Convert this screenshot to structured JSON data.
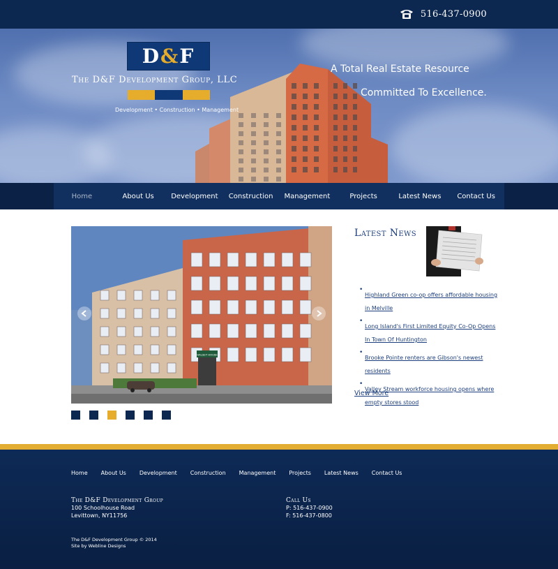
{
  "header": {
    "phone": "516-437-0900",
    "phone_icon": "telephone-icon"
  },
  "hero": {
    "logo_letters": {
      "left": "D",
      "amp": "&",
      "right": "F"
    },
    "company_name": "The D&F Development Group, LLC",
    "tagline": "Development • Construction • Management",
    "slogan_line1": "A Total Real Estate Resource",
    "slogan_line2": "Committed To Excellence.",
    "colors": {
      "navy": "#0f3877",
      "gold": "#e6ac2b"
    }
  },
  "nav": {
    "items": [
      {
        "label": "Home",
        "active": true
      },
      {
        "label": "About Us"
      },
      {
        "label": "Development"
      },
      {
        "label": "Construction"
      },
      {
        "label": "Management"
      },
      {
        "label": "Projects"
      },
      {
        "label": "Latest News"
      },
      {
        "label": "Contact Us"
      }
    ]
  },
  "slideshow": {
    "sign_text": "HALSEY HOUSE",
    "dots": 6,
    "active_dot": 3
  },
  "news": {
    "title": "Latest News",
    "items": [
      {
        "text": "Highland Green co-op offers affordable housing in Melville"
      },
      {
        "text": "Long Island's First Limited Equity Co-Op Opens In Town Of Huntington"
      },
      {
        "text": "Brooke Pointe renters are Gibson's newest residents"
      },
      {
        "text": "Valley Stream workforce housing opens where empty stores stood"
      }
    ],
    "view_more": "View More"
  },
  "footer": {
    "nav": [
      "Home",
      "About Us",
      "Development",
      "Construction",
      "Management",
      "Projects",
      "Latest News",
      "Contact Us"
    ],
    "company_title": "The D&F Development Group",
    "address1": "100 Schoolhouse Road",
    "address2": "Levittown, NY11756",
    "call_title": "Call Us",
    "phone": "P: 516-437-0900",
    "fax": "F: 516-437-0800",
    "copyright": "The D&F Development Group © 2014",
    "credit": "Site by Webline Designs"
  }
}
